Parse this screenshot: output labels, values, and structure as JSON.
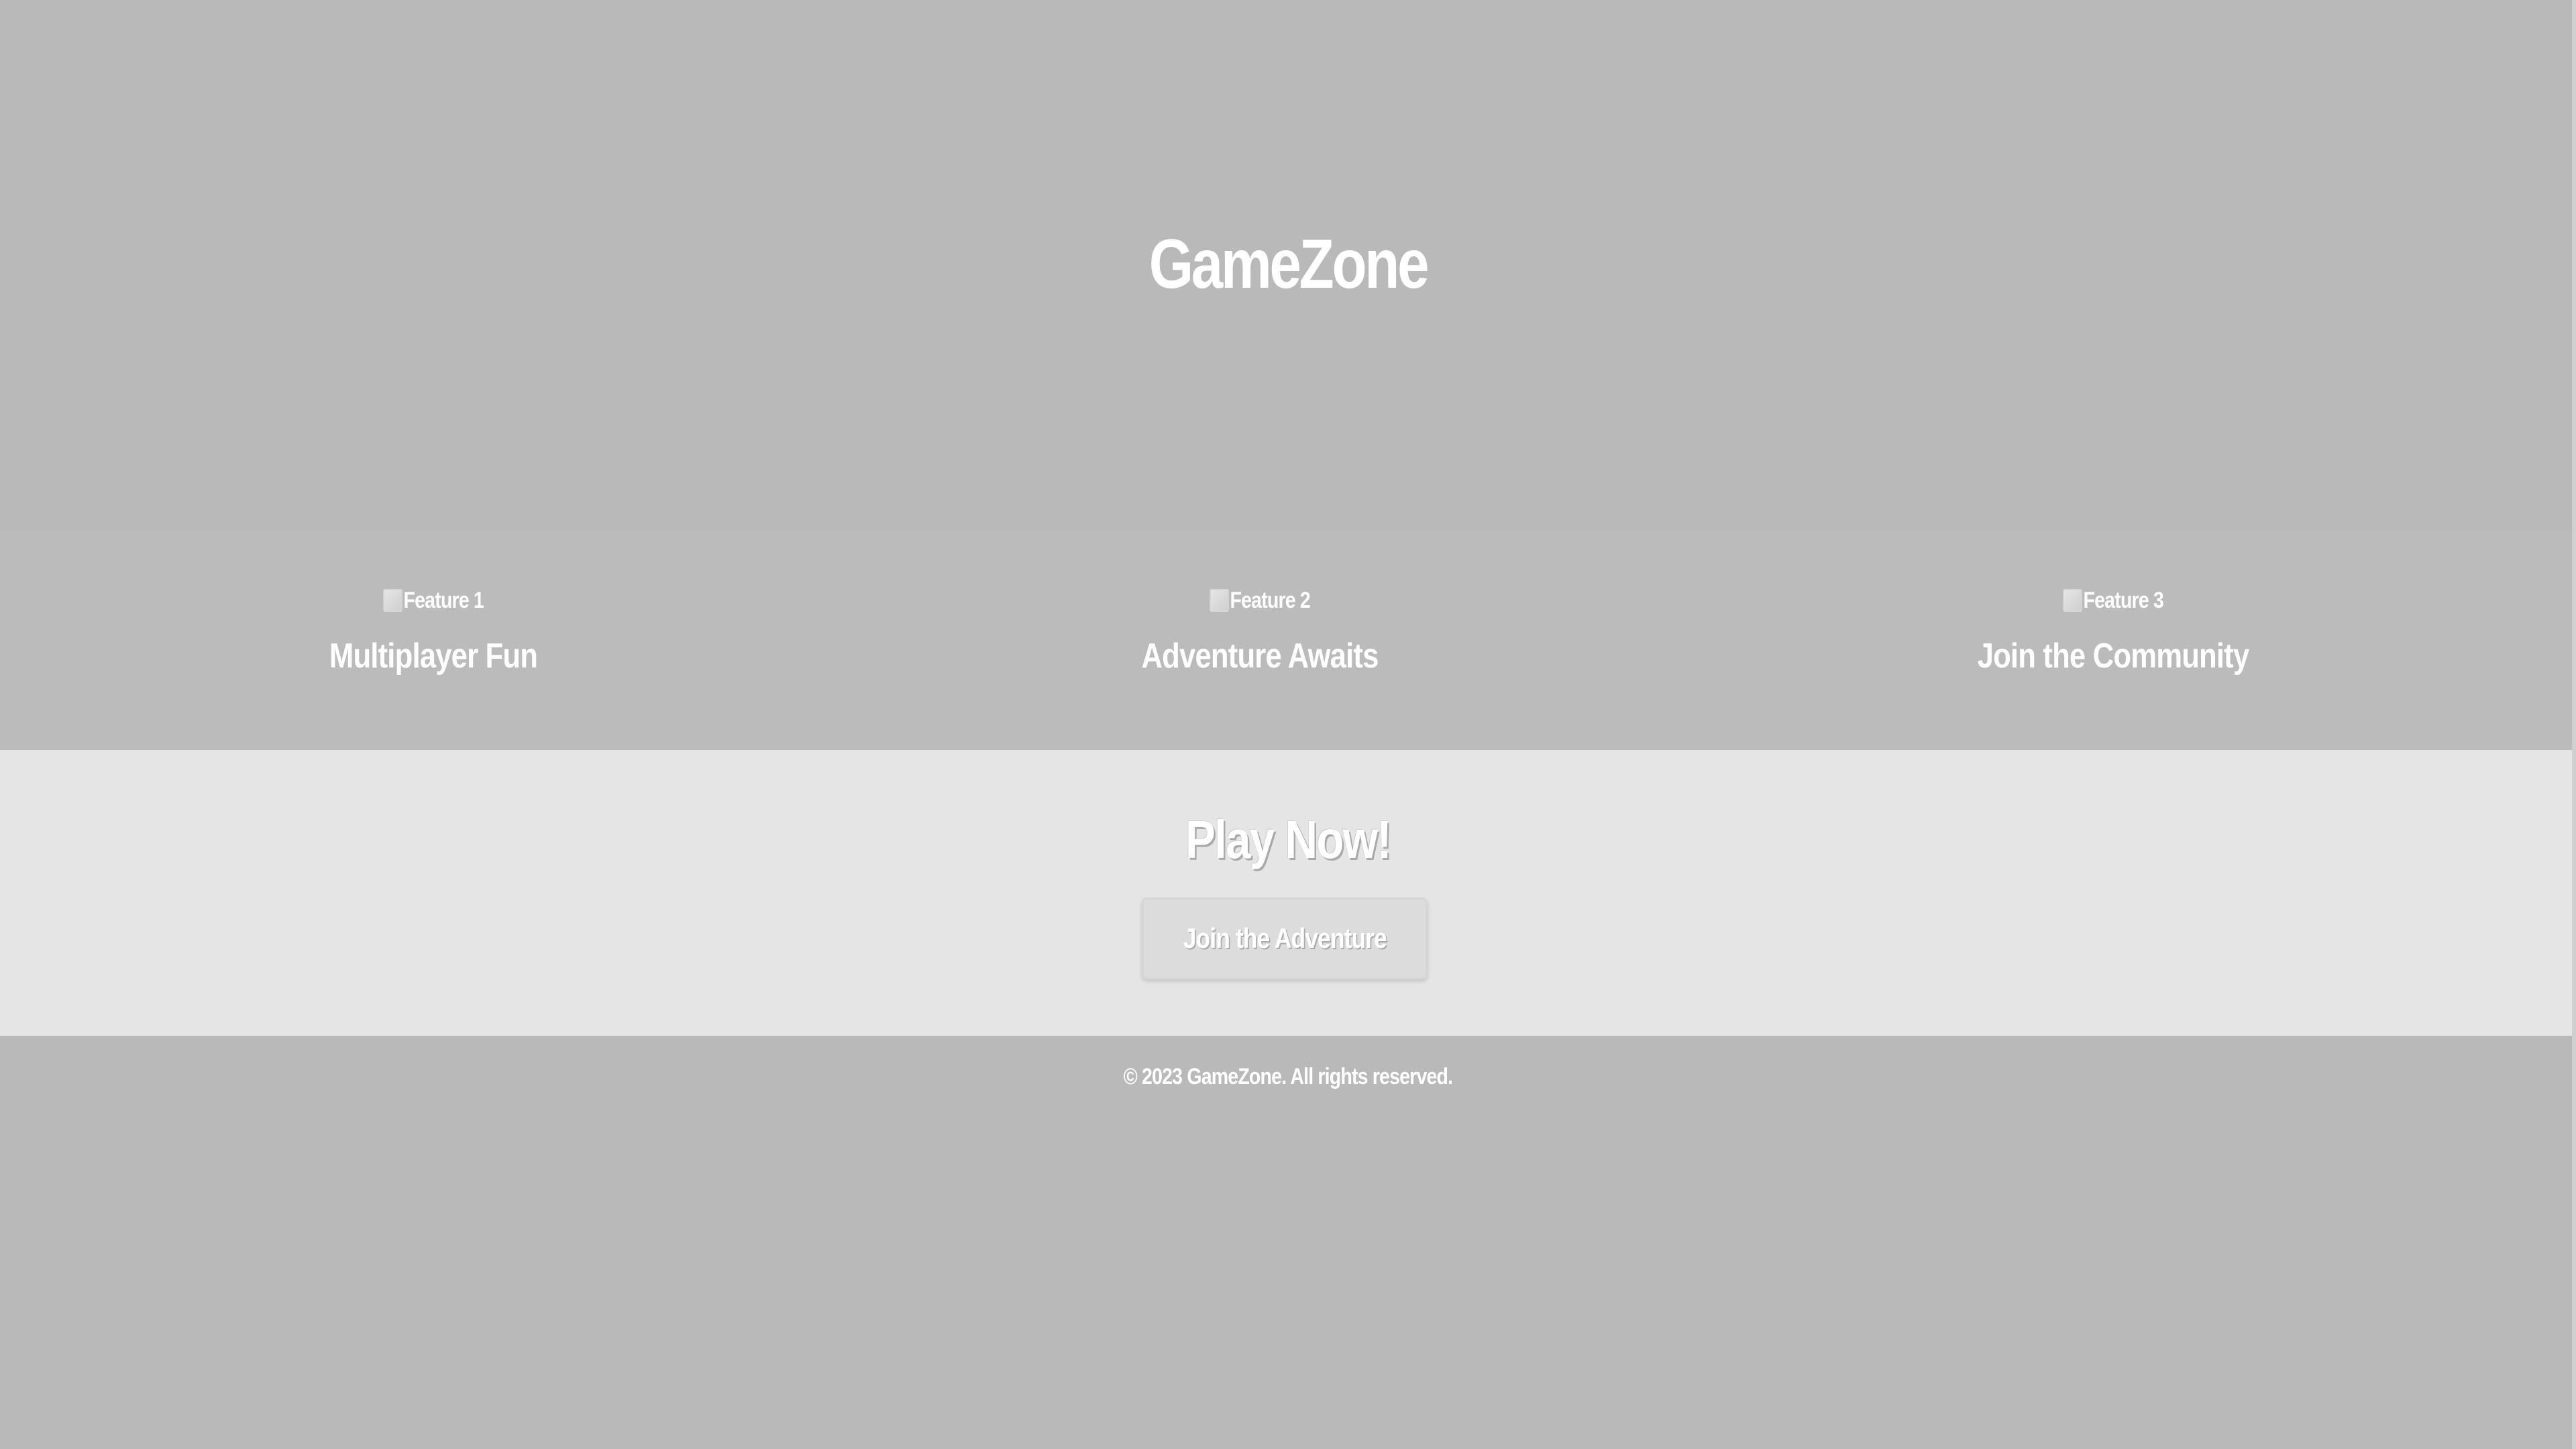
{
  "hero": {
    "title": "GameZone"
  },
  "features": [
    {
      "image_alt": "Feature 1",
      "title": "Multiplayer Fun"
    },
    {
      "image_alt": "Feature 2",
      "title": "Adventure Awaits"
    },
    {
      "image_alt": "Feature 3",
      "title": "Join the Community"
    }
  ],
  "cta": {
    "heading": "Play Now!",
    "button_label": "Join the Adventure"
  },
  "footer": {
    "copyright": "© 2023 GameZone. All rights reserved."
  },
  "colors": {
    "hero_bg": "#b9b9b9",
    "features_bg": "#bbbbbb",
    "cta_bg": "#e5e5e5",
    "footer_bg": "#b9b9b9",
    "text": "#ffffff"
  }
}
